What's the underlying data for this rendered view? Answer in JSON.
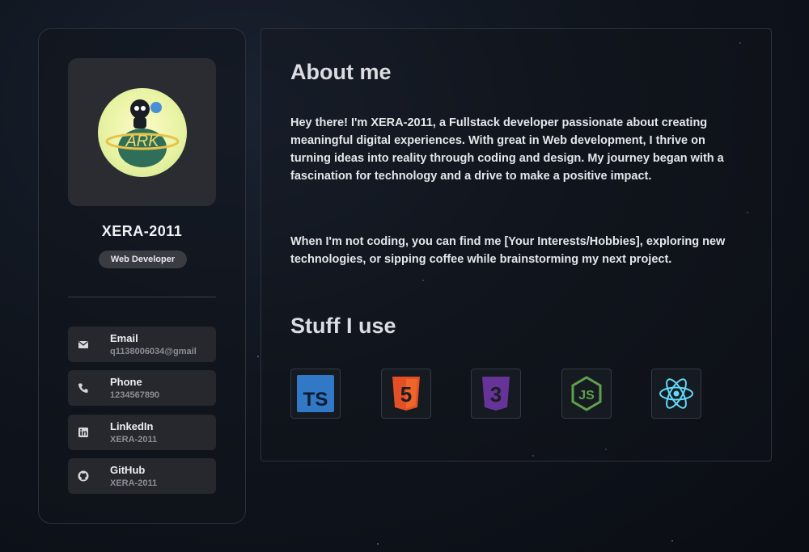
{
  "profile": {
    "name": "XERA-2011",
    "role": "Web Developer",
    "avatar_text": "ARK"
  },
  "contacts": [
    {
      "icon": "mail-icon",
      "label": "Email",
      "value": "q1138006034@gmail"
    },
    {
      "icon": "phone-icon",
      "label": "Phone",
      "value": "1234567890"
    },
    {
      "icon": "linkedin-icon",
      "label": "LinkedIn",
      "value": "XERA-2011"
    },
    {
      "icon": "github-icon",
      "label": "GitHub",
      "value": "XERA-2011"
    }
  ],
  "about": {
    "title": "About me",
    "paragraph1": "Hey there! I'm XERA-2011, a Fullstack developer passionate about creating meaningful digital experiences. With great in Web development, I thrive on turning ideas into reality through coding and design. My journey began with a fascination for technology and a drive to make a positive impact.",
    "paragraph2": "When I'm not coding, you can find me [Your Interests/Hobbies], exploring new technologies, or sipping coffee while brainstorming my next project."
  },
  "stuff": {
    "title": "Stuff I use",
    "tools": [
      {
        "icon": "typescript-icon",
        "label": "TS",
        "color": "#3178c6"
      },
      {
        "icon": "html5-icon",
        "label": "5",
        "color": "#e34f26"
      },
      {
        "icon": "css3-icon",
        "label": "3",
        "color": "#663399"
      },
      {
        "icon": "nodejs-icon",
        "label": "JS",
        "color": "#5fa04e"
      },
      {
        "icon": "react-icon",
        "color": "#61dafb"
      }
    ]
  }
}
